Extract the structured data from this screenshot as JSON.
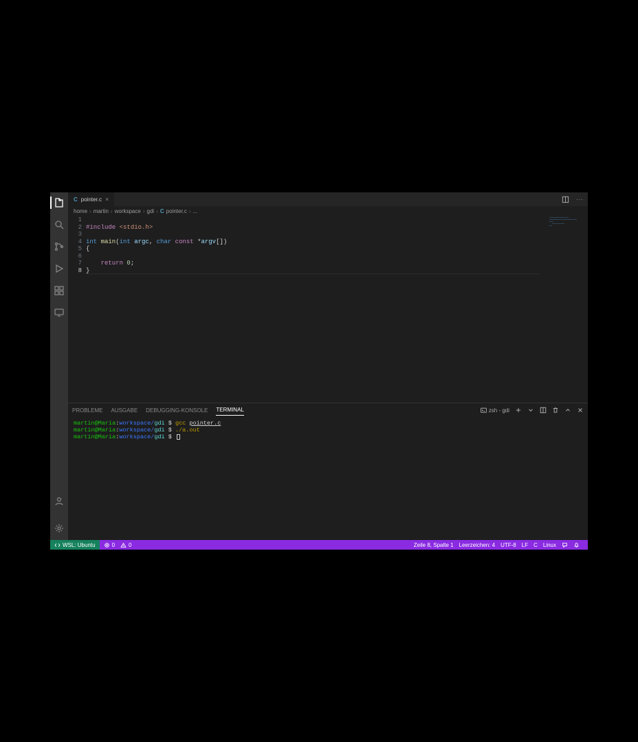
{
  "tab": {
    "filename": "pointer.c",
    "langShort": "C"
  },
  "tabActions": {
    "more": "···"
  },
  "breadcrumb": {
    "segments": [
      "home",
      "martin",
      "workspace",
      "gdi"
    ],
    "file": "pointer.c",
    "tail": "..."
  },
  "editor": {
    "lineNumbers": [
      "1",
      "2",
      "3",
      "4",
      "5",
      "6",
      "7",
      "8"
    ],
    "currentLineIndex": 7,
    "code": {
      "l1": {
        "include": "#include",
        "header": " <stdio.h>"
      },
      "l3": {
        "int1": "int",
        "fn": " main",
        "op": "(",
        "int2": "int",
        "argc": " argc",
        "comma": ", ",
        "char": "char",
        "const": " const",
        "star": " *",
        "argv": "argv",
        "brackets": "[]",
        "close": ")"
      },
      "l4": "{",
      "l6": {
        "indent": "    ",
        "return": "return",
        "num": " 0",
        "semi": ";"
      },
      "l7": "}"
    }
  },
  "panel": {
    "tabs": [
      "PROBLEME",
      "AUSGABE",
      "DEBUGGING-KONSOLE",
      "TERMINAL"
    ],
    "activeTabIndex": 3,
    "term": {
      "count": "1",
      "label": "zsh - gdi"
    }
  },
  "terminal": {
    "prompt": {
      "user": "martin",
      "at": "@",
      "host": "Maria",
      "sep": ":",
      "path": "workspace/",
      "pathend": "gdi",
      "dollar": " $ "
    },
    "line1": {
      "cmd": "gcc",
      "space": " ",
      "arg": "pointer.c"
    },
    "line2": {
      "cmd": "./a.out"
    }
  },
  "statusbar": {
    "remote": "WSL: Ubuntu",
    "errors": "0",
    "warnings": "0",
    "right": {
      "position": "Zeile 8, Spalte 1",
      "indent": "Leerzeichen: 4",
      "encoding": "UTF-8",
      "eol": "LF",
      "lang": "C",
      "os": "Linux"
    }
  }
}
